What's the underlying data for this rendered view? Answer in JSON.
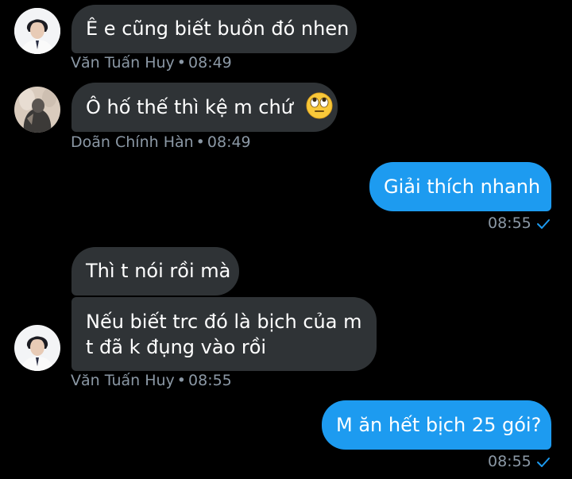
{
  "messages": [
    {
      "text": "Ê e cũng biết buồn đó nhen"
    },
    {
      "text": "Ô hố thế thì kệ m chứ",
      "emoji": "face-with-rolling-eyes-icon"
    },
    {
      "text": "Giải thích nhanh"
    },
    {
      "text": "Thì t nói rồi mà"
    },
    {
      "line1": "Nếu biết trc đó là bịch của m",
      "line2": "t đã k đụng vào rồi"
    },
    {
      "text": "M ăn hết bịch 25 gói?"
    }
  ],
  "meta": [
    {
      "name": "Văn Tuấn Huy",
      "time": "08:49"
    },
    {
      "name": "Doãn Chính Hàn",
      "time": "08:49"
    },
    {
      "time": "08:55"
    },
    {
      "name": "Văn Tuấn Huy",
      "time": "08:55"
    },
    {
      "time": "08:55"
    }
  ],
  "separator": "•",
  "colors": {
    "background": "#000000",
    "incoming_bubble": "#2f3336",
    "outgoing_bubble": "#1d9bf0",
    "meta_text": "#8b98a5",
    "read_check": "#1d9bf0"
  }
}
